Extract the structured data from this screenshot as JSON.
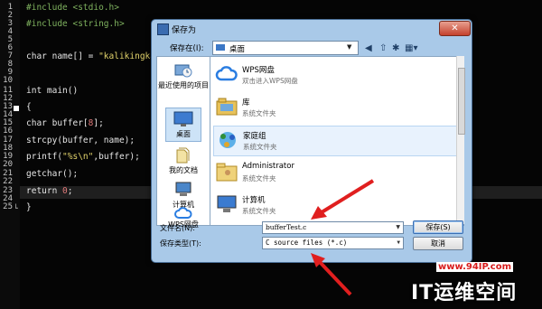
{
  "editor": {
    "line_numbers": [
      "1",
      "2",
      "3",
      "4",
      "5",
      "6",
      "7",
      "8",
      "9",
      "10",
      "11",
      "12",
      "13",
      "14",
      "15",
      "16",
      "17",
      "18",
      "19",
      "20",
      "21",
      "22",
      "23",
      "24",
      "25"
    ],
    "line1": "#include <stdio.h>",
    "line3": "#include <string.h>",
    "line7_pre": "char name[] = ",
    "line7_str": "\"kalikingkalik",
    "line11": "int main()",
    "line12": "{",
    "line14_pre": "char buffer[",
    "line14_num": "8",
    "line14_post": "];",
    "line16": "strcpy(buffer, name);",
    "line18_pre": "printf(",
    "line18_str": "\"%s\\n\"",
    "line18_post": ",buffer);",
    "line20": "getchar();",
    "line22_pre": "return ",
    "line22_num": "0",
    "line22_post": ";",
    "line25": "}"
  },
  "dialog": {
    "title": "保存为",
    "close_glyph": "✕",
    "save_in_label": "保存在(I):",
    "save_in_value": "桌面",
    "sidebar": [
      {
        "label": "最近使用的项目",
        "icon": "recent-items-icon"
      },
      {
        "label": "桌面",
        "icon": "desktop-icon"
      },
      {
        "label": "我的文档",
        "icon": "documents-icon"
      },
      {
        "label": "计算机",
        "icon": "computer-icon"
      },
      {
        "label": "WPS网盘",
        "icon": "cloud-icon"
      }
    ],
    "items": [
      {
        "title": "WPS网盘",
        "subtitle": "双击进入WPS网盘",
        "icon": "cloud-icon"
      },
      {
        "title": "库",
        "subtitle": "系统文件夹",
        "icon": "library-icon"
      },
      {
        "title": "家庭组",
        "subtitle": "系统文件夹",
        "icon": "homegroup-icon"
      },
      {
        "title": "Administrator",
        "subtitle": "系统文件夹",
        "icon": "user-folder-icon"
      },
      {
        "title": "计算机",
        "subtitle": "系统文件夹",
        "icon": "computer-icon"
      }
    ],
    "filename_label": "文件名(N):",
    "filename_value": "bufferTest.c",
    "filetype_label": "保存类型(T):",
    "filetype_value": "C source files (*.c)",
    "save_button": "保存(S)",
    "cancel_button": "取消"
  },
  "watermark": {
    "url": "www.94IP.com",
    "brand": "IT运维空间"
  },
  "colors": {
    "accent": "#d81b1b",
    "dialog_frame": "#a9c9e8"
  }
}
